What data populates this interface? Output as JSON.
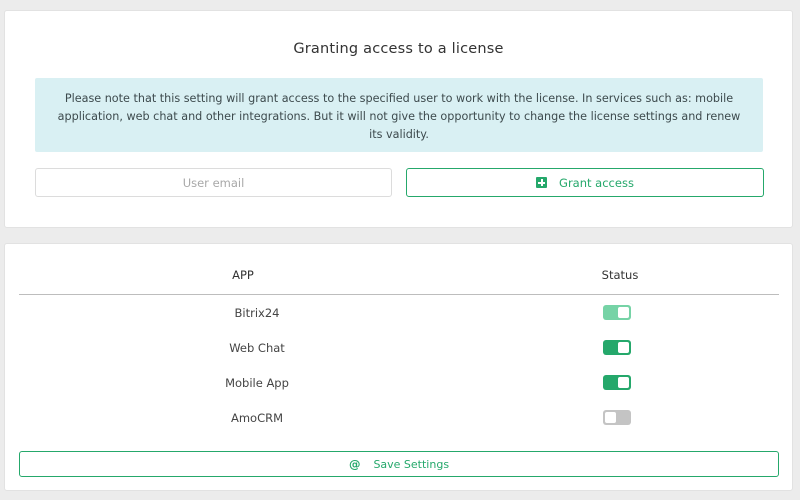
{
  "grant": {
    "title": "Granting access to a license",
    "notice": "Please note that this setting will grant access to the specified user to work with the license. In services such as: mobile application, web chat and other integrations. But it will not give the opportunity to change the license settings and renew its validity.",
    "email_placeholder": "User email",
    "email_value": "",
    "button_label": "Grant access",
    "button_icon": "plus-square-icon"
  },
  "apps_table": {
    "headers": {
      "app": "APP",
      "status": "Status"
    },
    "rows": [
      {
        "name": "Bitrix24",
        "enabled": true,
        "state": "on-disabled"
      },
      {
        "name": "Web Chat",
        "enabled": true,
        "state": "on"
      },
      {
        "name": "Mobile App",
        "enabled": true,
        "state": "on"
      },
      {
        "name": "AmoCRM",
        "enabled": false,
        "state": "off"
      }
    ],
    "save_label": "Save Settings",
    "save_icon": "at-icon"
  },
  "colors": {
    "accent": "#25a86b",
    "accent_light": "#76d3a6",
    "notice_bg": "#d9f0f3",
    "toggle_off": "#c4c4c4"
  }
}
